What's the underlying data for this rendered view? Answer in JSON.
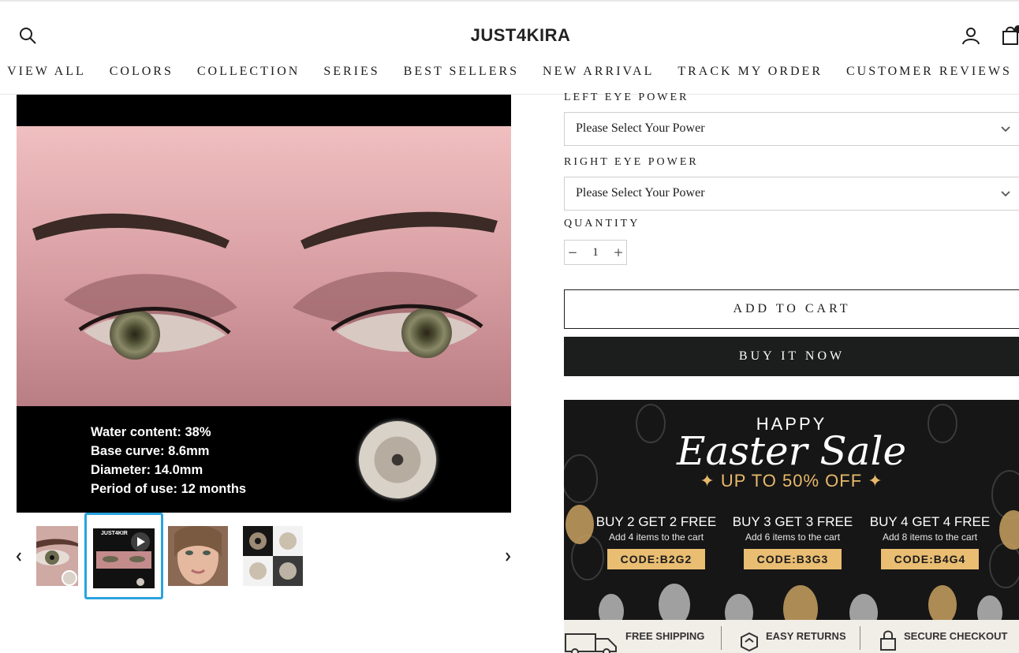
{
  "header": {
    "logo": "JUST4KIRA",
    "nav": [
      "VIEW ALL",
      "COLORS",
      "COLLECTION",
      "SERIES",
      "BEST SELLERS",
      "NEW ARRIVAL",
      "TRACK MY ORDER",
      "CUSTOMER REVIEWS"
    ]
  },
  "gallery": {
    "specs": [
      "Water content: 38%",
      "Base curve: 8.6mm",
      "Diameter: 14.0mm",
      "Period of use: 12 months"
    ],
    "video_thumb_logo": "JUST4KIR"
  },
  "product_form": {
    "left_eye_label": "LEFT EYE POWER",
    "left_eye_value": "Please Select Your Power",
    "right_eye_label": "RIGHT EYE POWER",
    "right_eye_value": "Please Select Your Power",
    "quantity_label": "QUANTITY",
    "quantity_value": "1",
    "add_to_cart": "ADD TO CART",
    "buy_now": "BUY IT NOW"
  },
  "banner": {
    "happy": "HAPPY",
    "script": "Easter Sale",
    "up_to": "✦ UP TO 50% OFF ✦",
    "offers": [
      {
        "title": "BUY 2 GET 2 FREE",
        "sub": "Add 4 items to the cart",
        "code": "CODE:B2G2"
      },
      {
        "title": "BUY 3 GET 3 FREE",
        "sub": "Add 6 items to the cart",
        "code": "CODE:B3G3"
      },
      {
        "title": "BUY 4 GET 4 FREE",
        "sub": "Add 8 items to the cart",
        "code": "CODE:B4G4"
      }
    ],
    "footer": [
      "FREE SHIPPING",
      "EASY RETURNS",
      "SECURE CHECKOUT"
    ]
  },
  "colors": {
    "accent": "#2aa3e0",
    "button_dark": "#1c1d1d",
    "banner_gold": "#e9bd72"
  }
}
